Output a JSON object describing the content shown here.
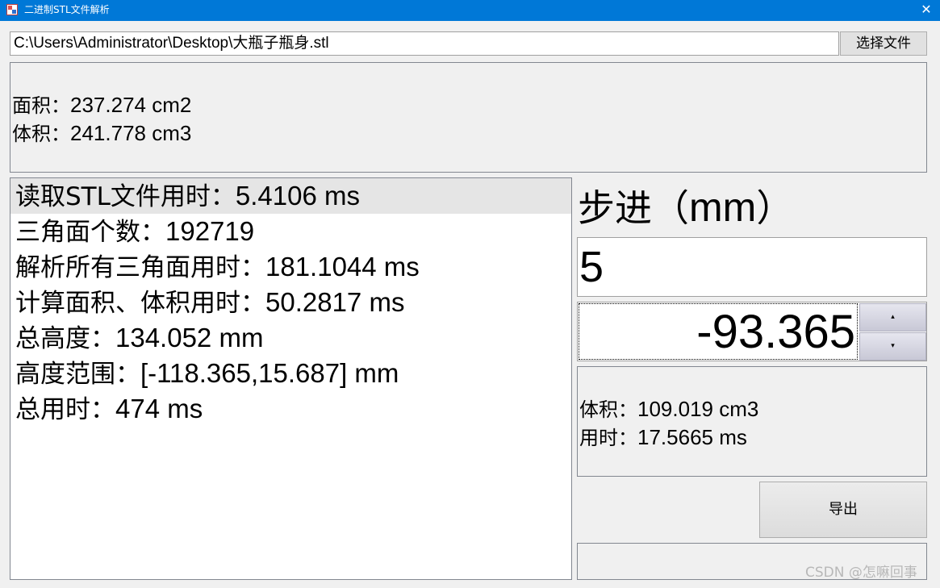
{
  "window": {
    "title": "二进制STL文件解析",
    "close_glyph": "✕"
  },
  "file": {
    "path": "C:\\Users\\Administrator\\Desktop\\大瓶子瓶身.stl",
    "choose_button": "选择文件"
  },
  "summary": {
    "area_label": "面积：",
    "area_value": "237.274 cm2",
    "volume_label": "体积：",
    "volume_value": "241.778 cm3"
  },
  "log": [
    {
      "label": "读取STL文件用时：",
      "value": "5.4106 ms"
    },
    {
      "label": "三角面个数：",
      "value": "192719"
    },
    {
      "label": "解析所有三角面用时：",
      "value": "181.1044 ms"
    },
    {
      "label": "计算面积、体积用时：",
      "value": "50.2817 ms"
    },
    {
      "label": "总高度：",
      "value": "134.052 mm"
    },
    {
      "label": "高度范围：",
      "value": "[-118.365,15.687] mm"
    },
    {
      "label": "总用时：",
      "value": "474 ms"
    }
  ],
  "step": {
    "label_cjk": "步进（",
    "label_unit": "mm",
    "label_close": "）",
    "value": "5"
  },
  "height_spinner": {
    "value": "-93.365",
    "up_glyph": "▴",
    "down_glyph": "▾"
  },
  "result": {
    "volume_label": "体积：",
    "volume_value": "109.019 cm3",
    "time_label": "用时：",
    "time_value": "17.5665 ms"
  },
  "export_button": "导出",
  "watermark": "CSDN @怎嘛回事"
}
